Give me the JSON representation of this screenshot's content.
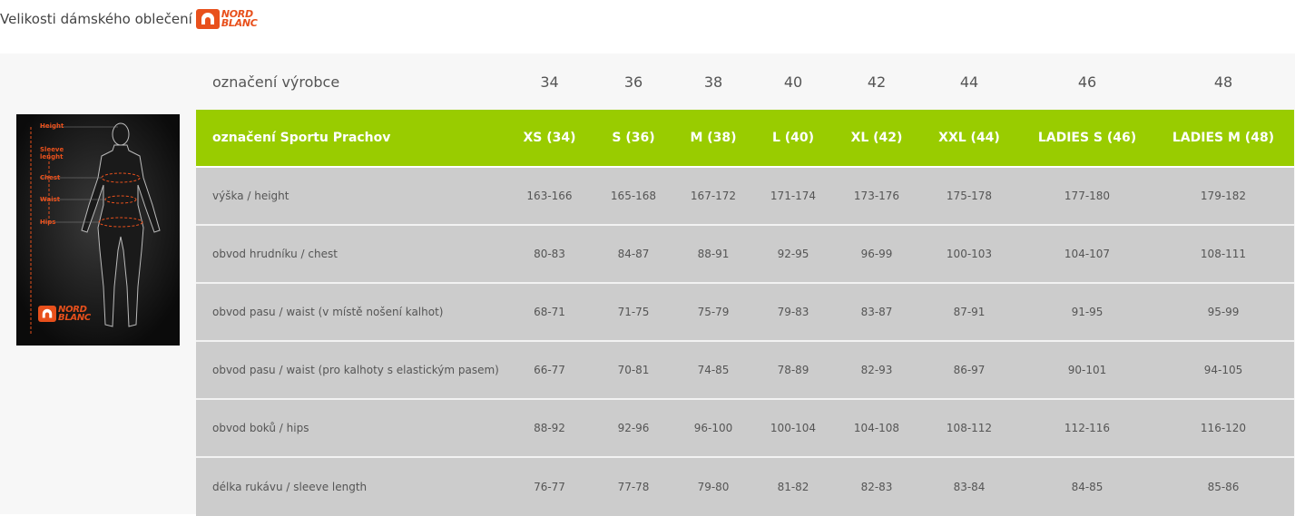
{
  "title": "Velikosti dámského oblečení",
  "brand": {
    "line1": "NORD",
    "line2": "BLANC",
    "color": "#e8501c"
  },
  "figure_labels": [
    "Height",
    "Sleeve lenght",
    "Chest",
    "Waist",
    "Hips"
  ],
  "colors": {
    "accent_green": "#99cc00",
    "data_bg": "#cccccc",
    "brand_orange": "#e8501c"
  },
  "table": {
    "manufacturer_label": "označení výrobce",
    "manufacturer_sizes": [
      "34",
      "36",
      "38",
      "40",
      "42",
      "44",
      "46",
      "48"
    ],
    "sport_label": "označení Sportu Prachov",
    "sport_sizes": [
      "XS (34)",
      "S (36)",
      "M (38)",
      "L (40)",
      "XL (42)",
      "XXL (44)",
      "LADIES S (46)",
      "LADIES M (48)"
    ],
    "rows": [
      {
        "label": "výška / height",
        "values": [
          "163-166",
          "165-168",
          "167-172",
          "171-174",
          "173-176",
          "175-178",
          "177-180",
          "179-182"
        ]
      },
      {
        "label": "obvod hrudníku / chest",
        "values": [
          "80-83",
          "84-87",
          "88-91",
          "92-95",
          "96-99",
          "100-103",
          "104-107",
          "108-111"
        ]
      },
      {
        "label": "obvod pasu / waist (v místě nošení kalhot)",
        "values": [
          "68-71",
          "71-75",
          "75-79",
          "79-83",
          "83-87",
          "87-91",
          "91-95",
          "95-99"
        ]
      },
      {
        "label": "obvod pasu / waist (pro kalhoty s elastickým pasem)",
        "values": [
          "66-77",
          "70-81",
          "74-85",
          "78-89",
          "82-93",
          "86-97",
          "90-101",
          "94-105"
        ]
      },
      {
        "label": "obvod boků / hips",
        "values": [
          "88-92",
          "92-96",
          "96-100",
          "100-104",
          "104-108",
          "108-112",
          "112-116",
          "116-120"
        ]
      },
      {
        "label": "délka rukávu / sleeve length",
        "values": [
          "76-77",
          "77-78",
          "79-80",
          "81-82",
          "82-83",
          "83-84",
          "84-85",
          "85-86"
        ]
      }
    ]
  }
}
